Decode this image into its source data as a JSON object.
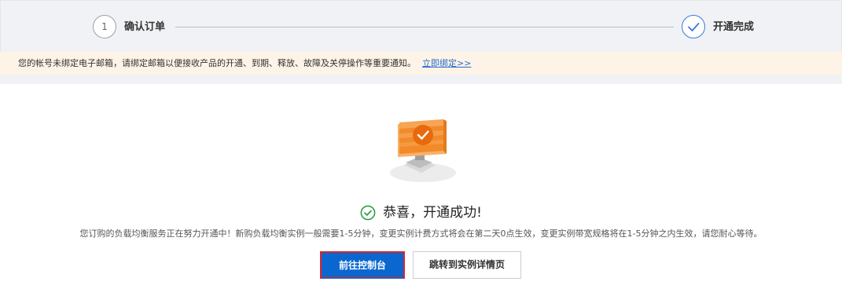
{
  "steps": {
    "step1_number": "1",
    "step1_label": "确认订单",
    "step2_label": "开通完成"
  },
  "notice": {
    "text": "您的帐号未绑定电子邮箱，请绑定邮箱以便接收产品的开通、到期、释放、故障及关停操作等重要通知。",
    "link": "立即绑定>>"
  },
  "result": {
    "title": "恭喜，开通成功!",
    "description": "您订购的负载均衡服务正在努力开通中！新购负载均衡实例一般需要1-5分钟，变更实例计费方式将会在第二天0点生效，变更实例带宽规格将在1-5分钟之内生效，请您耐心等待。"
  },
  "buttons": {
    "console": "前往控制台",
    "details": "跳转到实例详情页"
  },
  "colors": {
    "accent": "#0b67d0",
    "success": "#2e9e44",
    "illustration_orange": "#f07b1d",
    "notice_bg": "#fdf3e6"
  },
  "icons": [
    "check-icon",
    "success-check-icon",
    "computer-illustration"
  ]
}
